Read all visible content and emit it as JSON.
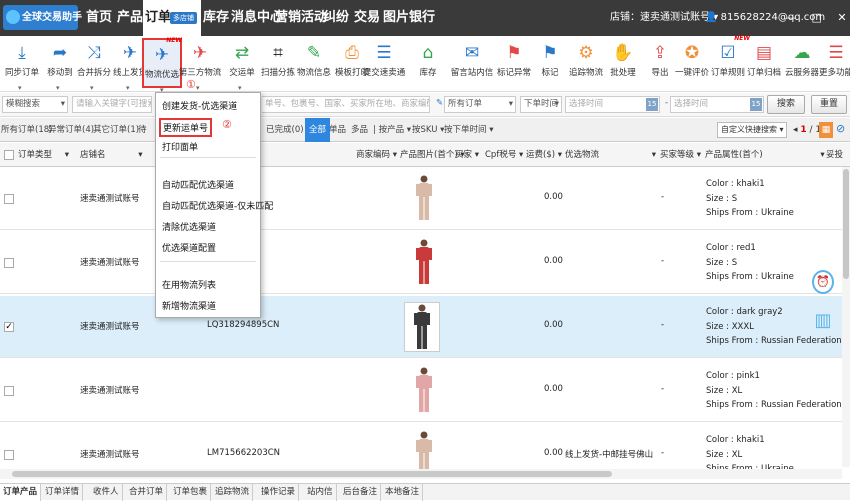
{
  "topbar": {
    "logo": "全球交易助手",
    "nav": [
      "首页",
      "产品",
      "订单",
      "库存",
      "消息中心",
      "营销活动",
      "纠纷",
      "交易",
      "图片银行"
    ],
    "order_badge": "多店铺",
    "store_label": "店铺：",
    "store_name": "速卖通测试账号",
    "user_email": "815628224@qq.com",
    "window_controls": "— □ ✕"
  },
  "toolbar": {
    "items": [
      {
        "label": "同步订单",
        "icon": "sync-download-icon",
        "color": "#2b78c8"
      },
      {
        "label": "移动到",
        "icon": "move-icon",
        "color": "#2b78c8"
      },
      {
        "label": "合并拆分",
        "icon": "shuffle-icon",
        "color": "#2b78c8"
      },
      {
        "label": "线上发货",
        "icon": "ship-online-icon",
        "color": "#2b78c8"
      },
      {
        "label": "物流优选",
        "icon": "logistics-optimize-icon",
        "color": "#2b78c8",
        "new": "NEW"
      },
      {
        "label": "第三方物流",
        "icon": "third-party-icon",
        "color": "#e24a4a"
      },
      {
        "label": "交运单",
        "icon": "exchange-icon",
        "color": "#36a64f"
      },
      {
        "label": "扫描分拣",
        "icon": "scan-icon",
        "color": "#333333"
      },
      {
        "label": "物流信息",
        "icon": "pencil-icon",
        "color": "#36a64f"
      },
      {
        "label": "模板打印",
        "icon": "printer-icon",
        "color": "#f0913a"
      },
      {
        "label": "提交速卖通",
        "icon": "document-icon",
        "color": "#2b78c8"
      },
      {
        "label": "库存",
        "icon": "warehouse-icon",
        "color": "#36a64f"
      },
      {
        "label": "留言站内信",
        "icon": "chat-icon",
        "color": "#2b78c8"
      },
      {
        "label": "标记异常",
        "icon": "red-flag-icon",
        "color": "#e24a4a"
      },
      {
        "label": "标记",
        "icon": "blue-flag-icon",
        "color": "#2b78c8"
      },
      {
        "label": "追踪物流",
        "icon": "track-icon",
        "color": "#f0913a"
      },
      {
        "label": "批处理",
        "icon": "batch-icon",
        "color": "#f0913a"
      },
      {
        "label": "导出",
        "icon": "export-icon",
        "color": "#e24a4a"
      },
      {
        "label": "一键评价",
        "icon": "rate-icon",
        "color": "#f0913a"
      },
      {
        "label": "订单规则",
        "icon": "rule-icon",
        "color": "#2b78c8",
        "new": "NEW"
      },
      {
        "label": "订单归档",
        "icon": "archive-icon",
        "color": "#e24a4a"
      },
      {
        "label": "云服务器",
        "icon": "cloud-icon",
        "color": "#36a64f"
      },
      {
        "label": "更多功能",
        "icon": "menu-icon",
        "color": "#e24a4a"
      }
    ]
  },
  "filter": {
    "mode": "模糊搜索",
    "keyword_placeholder": "请输入关键字(可搜索...",
    "keyword_hint": "单号、包裹号、国家、买家所在地、商家编码...",
    "order_select": "所有订单",
    "time_type": "下单时间",
    "time_from": "选择时间",
    "time_to": "选择时间",
    "search_btn": "搜索",
    "reset_btn": "重置"
  },
  "tabs": {
    "items": [
      "所有订单(18)",
      "异常订单(4)",
      "其它订单(1)",
      "待"
    ],
    "done": "已完成(0)",
    "all": "全部",
    "single": "单品",
    "multi": "多品",
    "by_product": "按产品",
    "by_sku": "按SKU",
    "by_time": "按下单时间",
    "custom_search": "自定义快捷搜索",
    "page": "1",
    "pages": "/ 13"
  },
  "columns": [
    "订单类型",
    "店铺名",
    "商家编码",
    "产品图片(首个)",
    "买家",
    "Cpf税号",
    "运费($)",
    "优选物流",
    "买家等级",
    "产品属性(首个)",
    "妥投"
  ],
  "rows": [
    {
      "checked": "",
      "store": "速卖通测试账号",
      "tracking": "",
      "shipping": "0.00",
      "logistics": "",
      "level": "-",
      "color": "#d9b9a8",
      "props": [
        "Color : khaki1",
        "Size : S",
        "Ships From : Ukraine"
      ]
    },
    {
      "checked": "",
      "store": "速卖通测试账号",
      "tracking": "",
      "shipping": "0.00",
      "logistics": "",
      "level": "-",
      "color": "#c93a3a",
      "props": [
        "Color : red1",
        "Size : S",
        "Ships From : Ukraine"
      ]
    },
    {
      "checked": "✓",
      "store": "速卖通测试账号",
      "tracking": "LQ318294895CN",
      "shipping": "0.00",
      "logistics": "",
      "level": "-",
      "color": "#3a3a3a",
      "props": [
        "Color : dark gray2",
        "Size : XXXL",
        "Ships From : Russian Federation"
      ]
    },
    {
      "checked": "",
      "store": "速卖通测试账号",
      "tracking": "",
      "shipping": "0.00",
      "logistics": "",
      "level": "-",
      "color": "#e3a6a6",
      "props": [
        "Color : pink1",
        "Size : XL",
        "Ships From : Russian Federation"
      ]
    },
    {
      "checked": "",
      "store": "速卖通测试账号",
      "tracking": "LM715662203CN",
      "shipping": "0.00",
      "logistics": "线上发货-中邮挂号佛山",
      "level": "-",
      "color": "#d9b9a8",
      "props": [
        "Color : khaki1",
        "Size : XL",
        "Ships From : Ukraine"
      ]
    }
  ],
  "dropdown": {
    "items": [
      "创建发货-优选渠道",
      "更新运单号",
      "打印面单",
      "自动匹配优选渠道",
      "自动匹配优选渠道-仅未匹配",
      "清除优选渠道",
      "优选渠道配置",
      "在用物流列表",
      "新增物流渠道"
    ],
    "marker1": "①",
    "marker2": "②"
  },
  "bottom_tabs": [
    "订单产品",
    "订单详情",
    "收件人",
    "合并订单",
    "订单包裹",
    "追踪物流",
    "操作记录",
    "站内信",
    "后台备注",
    "本地备注"
  ]
}
